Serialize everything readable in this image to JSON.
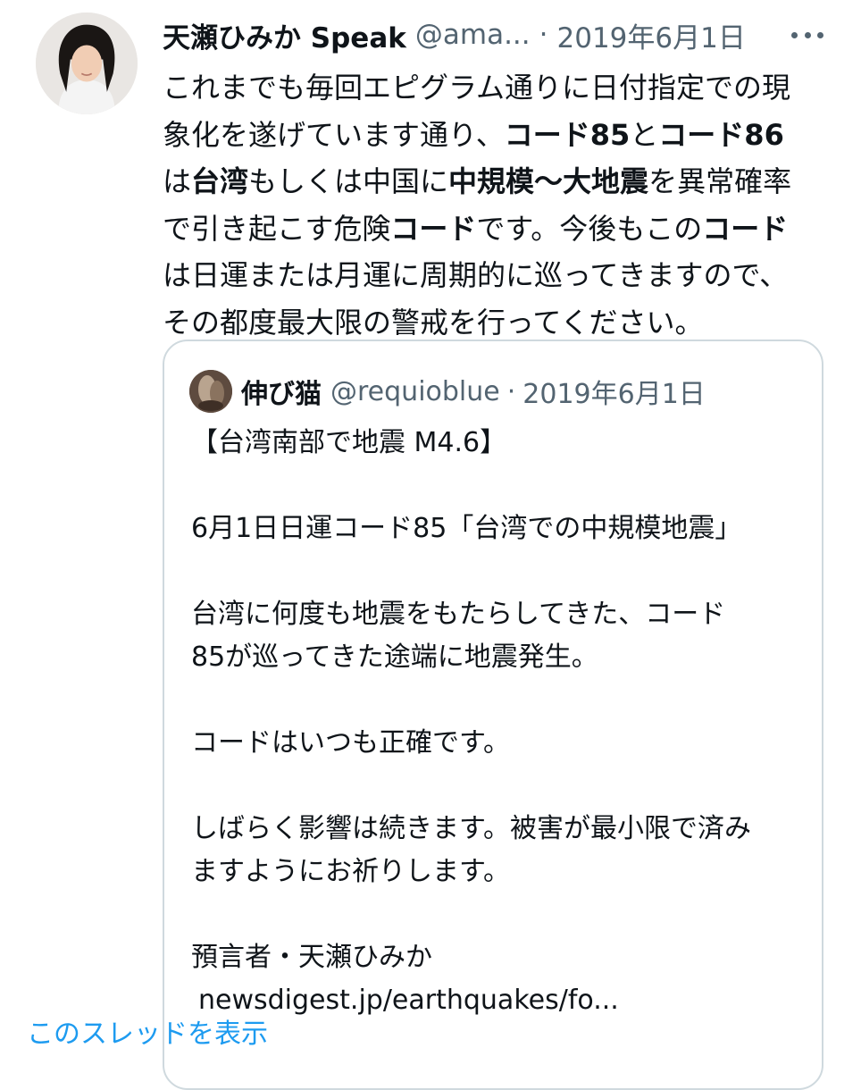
{
  "tweet": {
    "display_name": "天瀬ひみか Speak",
    "handle": "@ama...",
    "separator": "·",
    "date": "2019年6月1日",
    "text_runs": [
      {
        "text": "これまでも毎回エピグラム通りに日付指定での現象化を遂げています通り、",
        "bold": false
      },
      {
        "text": "コード85",
        "bold": true
      },
      {
        "text": "と",
        "bold": false
      },
      {
        "text": "コード86",
        "bold": true
      },
      {
        "text": "は",
        "bold": false
      },
      {
        "text": "台湾",
        "bold": true
      },
      {
        "text": "もしくは中国に",
        "bold": false
      },
      {
        "text": "中規模〜大地震",
        "bold": true
      },
      {
        "text": "を異常確率で引き起こす危険",
        "bold": false
      },
      {
        "text": "コード",
        "bold": true
      },
      {
        "text": "です。今後もこの",
        "bold": false
      },
      {
        "text": "コード",
        "bold": true
      },
      {
        "text": "は日運または月運に周期的に巡ってきますので、その都度最大限の警戒を行ってください。",
        "bold": false
      }
    ]
  },
  "quote": {
    "display_name": "伸び猫",
    "handle": "@requioblue",
    "separator": "·",
    "date": "2019年6月1日",
    "lines": [
      "【台湾南部で地震 M4.6】",
      "",
      "6月1日日運コード85「台湾での中規模地震」",
      "",
      "台湾に何度も地震をもたらしてきた、コード",
      "85が巡ってきた途端に地震発生。",
      "",
      "コードはいつも正確です。",
      "",
      "しばらく影響は続きます。被害が最小限で済み",
      "ますようにお祈りします。",
      "",
      "預言者・天瀬ひみか"
    ],
    "link": "newsdigest.jp/earthquakes/fo...",
    "show_thread": "このスレッドを表示"
  },
  "icons": {
    "more": "more-options-icon"
  },
  "colors": {
    "text": "#0f1419",
    "secondary": "#536471",
    "link": "#1d9bf0",
    "border": "#cfd9de"
  }
}
